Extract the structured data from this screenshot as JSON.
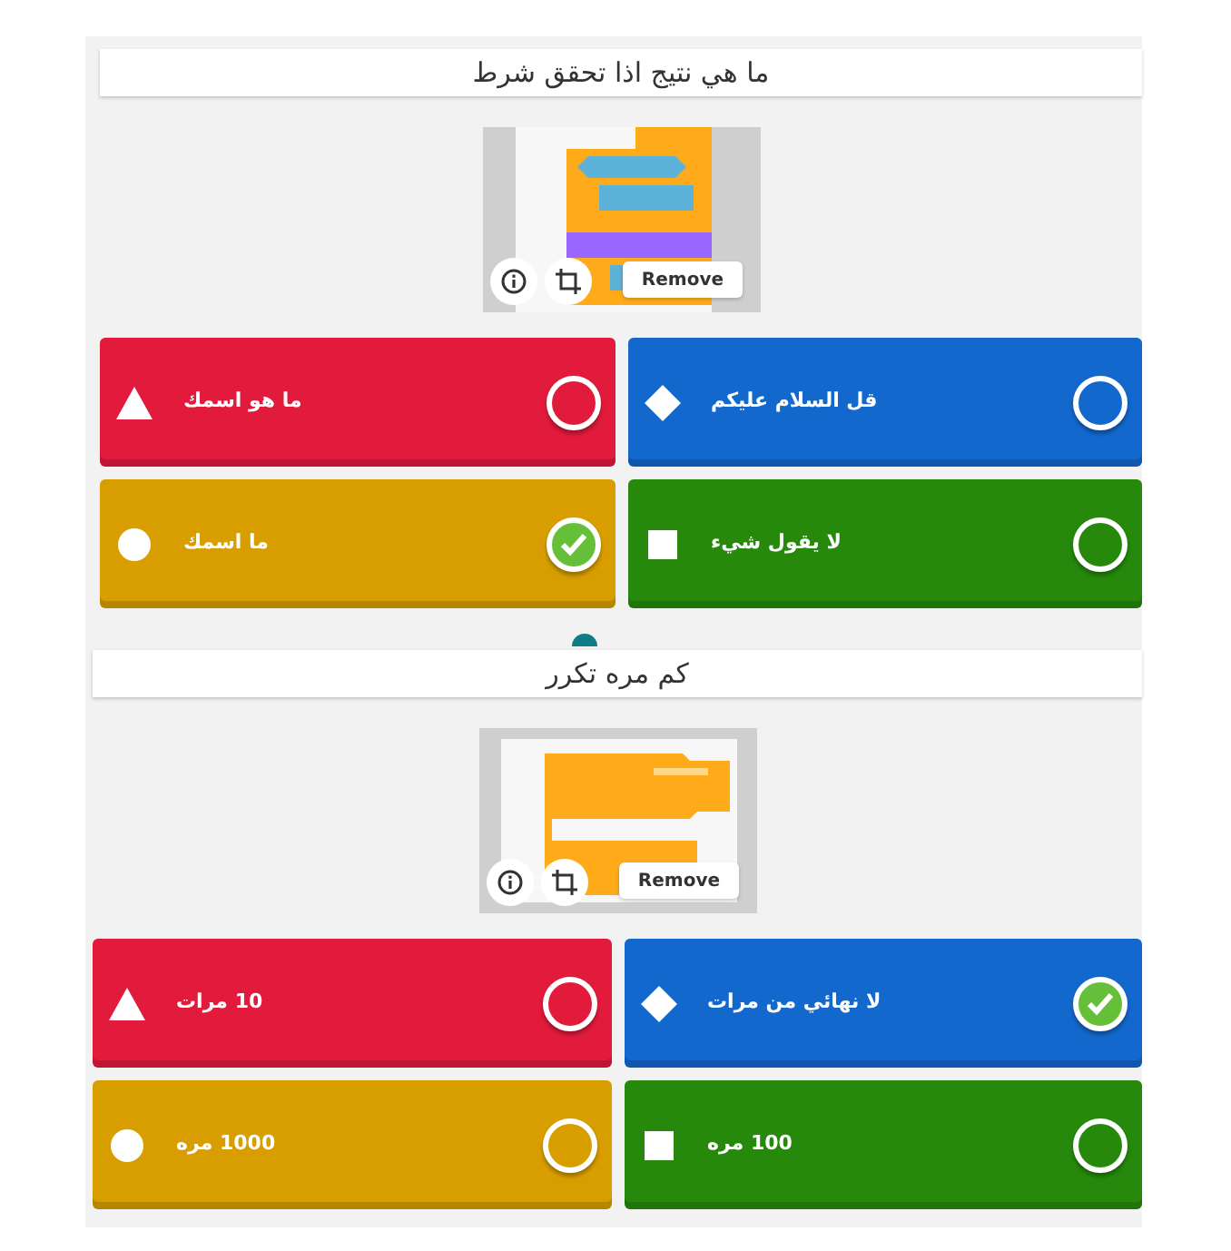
{
  "questions": [
    {
      "title": "ما هي نتيج  اذا تحقق شرط",
      "image": {
        "kind": "picture",
        "remove_label": "Remove"
      },
      "answers": [
        {
          "text": "قل السلام عليكم",
          "kind": "diamond",
          "color": "#1368ce",
          "correct": false
        },
        {
          "text": "ما  هو اسمك",
          "kind": "triangle",
          "color": "#e21b3c",
          "correct": false
        },
        {
          "text": "لا يقول شيء",
          "kind": "square",
          "color": "#26890c",
          "correct": false
        },
        {
          "text": "ما اسمك",
          "kind": "circle",
          "color": "#d89e00",
          "correct": true
        }
      ],
      "add_more": true
    },
    {
      "title": "كم  مره تكرر",
      "image": {
        "kind": "picture",
        "remove_label": "Remove"
      },
      "answers": [
        {
          "text": "لا نهائي من مرات",
          "kind": "diamond",
          "color": "#1368ce",
          "correct": true
        },
        {
          "text": "10 مرات",
          "kind": "triangle",
          "color": "#e21b3c",
          "correct": false
        },
        {
          "text": "100 مره",
          "kind": "square",
          "color": "#26890c",
          "correct": false
        },
        {
          "text": "1000 مره",
          "kind": "circle",
          "color": "#d89e00",
          "correct": false
        }
      ]
    }
  ]
}
